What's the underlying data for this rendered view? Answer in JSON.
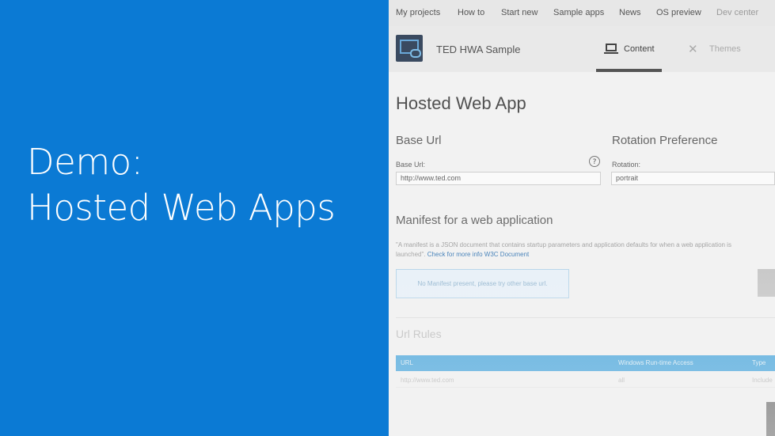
{
  "slide": {
    "title_line1": "Demo:",
    "title_line2": "Hosted Web Apps",
    "background_color": "#0b7ad4"
  },
  "topnav": {
    "items": [
      "My projects",
      "How to",
      "Start new",
      "Sample apps",
      "News",
      "OS preview",
      "Dev center"
    ]
  },
  "app": {
    "icon": "app-tile-icon",
    "name": "TED HWA Sample",
    "tabs": [
      {
        "label": "Content",
        "icon": "monitor-icon",
        "active": true
      },
      {
        "label": "Themes",
        "icon": "tools-icon",
        "active": false
      }
    ]
  },
  "page": {
    "title": "Hosted Web App",
    "base_url": {
      "heading": "Base Url",
      "label": "Base Url:",
      "value": "http://www.ted.com",
      "help": "?"
    },
    "rotation": {
      "heading": "Rotation Preference",
      "label": "Rotation:",
      "value": "portrait"
    },
    "manifest": {
      "heading": "Manifest for a web application",
      "desc_line1": "\"A manifest is a JSON document that contains startup parameters and application defaults for when a web application is",
      "desc_line2_prefix": "launched\".",
      "desc_link": "Check for more info W3C Document",
      "notice": "No Manifest present, please try other base url."
    },
    "url_rules": {
      "heading": "Url Rules",
      "columns": [
        "URL",
        "Windows Run-time Access",
        "Type"
      ],
      "rows": [
        {
          "url": "http://www.ted.com",
          "access": "all",
          "type": "Include"
        }
      ]
    }
  }
}
